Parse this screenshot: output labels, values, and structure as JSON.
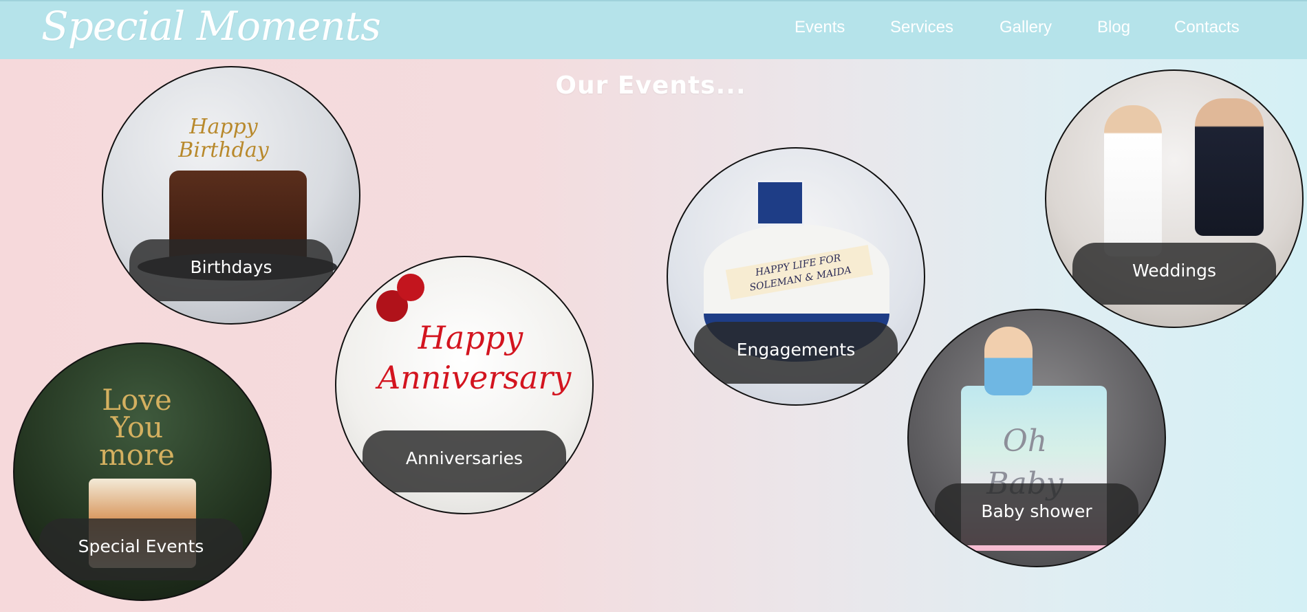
{
  "header": {
    "logo": "Special Moments",
    "nav": [
      "Events",
      "Services",
      "Gallery",
      "Blog",
      "Contacts"
    ],
    "colors": {
      "bar": "#b5e3ea",
      "text": "#ffffff"
    }
  },
  "main": {
    "title": "Our Events...",
    "events": [
      {
        "label": "Birthdays",
        "topper": "Happy Birthday"
      },
      {
        "label": "Anniversaries",
        "topper": "Happy Anniversary"
      },
      {
        "label": "Engagements",
        "topper": "HAPPY LIFE FOR SOLEMAN & MAIDA"
      },
      {
        "label": "Weddings"
      },
      {
        "label": "Special Events",
        "topper": "Love You more"
      },
      {
        "label": "Baby shower",
        "topper": "Oh Baby"
      }
    ]
  }
}
